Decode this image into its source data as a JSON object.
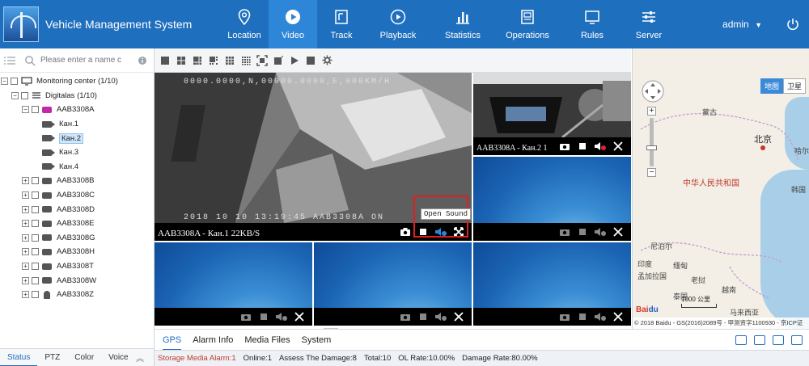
{
  "app": {
    "title": "Vehicle Management System"
  },
  "nav": [
    {
      "label": "Location",
      "icon": "location-pin-icon"
    },
    {
      "label": "Video",
      "icon": "play-circle-icon",
      "active": true
    },
    {
      "label": "Track",
      "icon": "track-icon"
    },
    {
      "label": "Playback",
      "icon": "playback-icon"
    },
    {
      "label": "Statistics",
      "icon": "bar-chart-icon"
    },
    {
      "label": "Operations",
      "icon": "operations-icon"
    },
    {
      "label": "Rules",
      "icon": "rules-icon"
    },
    {
      "label": "Server",
      "icon": "sliders-icon"
    }
  ],
  "user": {
    "name": "admin",
    "dropdown": "▼"
  },
  "search": {
    "placeholder": "Please enter a name c"
  },
  "tree": {
    "root": "Monitoring center  (1/10)",
    "group": "Digitalas  (1/10)",
    "vehicle": "AAB3308A",
    "channels": [
      "Кан.1",
      "Кан.2",
      "Кан.3",
      "Кан.4"
    ],
    "others": [
      "AAB3308B",
      "AAB3308C",
      "AAB3308D",
      "AAB3308E",
      "AAB3308G",
      "AAB3308H",
      "AAB3308T",
      "AAB3308W",
      "AAB3308Z"
    ]
  },
  "left_tabs": [
    "Status",
    "PTZ",
    "Color",
    "Voice"
  ],
  "video": {
    "main_osd_top": "0000.0000,N,00000.0000,E,000KM/H",
    "main_osd_bottom": "2018 10 10 13:19:45 AAB3308A ON",
    "main_label": "AAB3308A - Кан.1 22KB/S",
    "second_label": "AAB3308A - Кан.2 1",
    "tooltip": "Open Sound"
  },
  "bottom_tabs": [
    "GPS",
    "Alarm Info",
    "Media Files",
    "System"
  ],
  "status": {
    "alarm": "Storage Media Alarm:1",
    "online": "Online:1",
    "damage": "Assess The Damage:8",
    "total": "Total:10",
    "ol_rate": "OL Rate:10.00%",
    "damage_rate": "Damage Rate:80.00%"
  },
  "map": {
    "type_map": "地图",
    "type_sat": "卫星",
    "labels": {
      "mongolia": "蒙古",
      "beijing": "北京",
      "china": "中华人民共和国",
      "nepal": "尼泊尔",
      "mianbo": "缅甸",
      "bangladesh": "孟加拉国",
      "india": "印度",
      "thailand": "泰国",
      "laos": "老挝",
      "vietnam": "越南",
      "haerbin": "哈尔",
      "seoul": "韩国",
      "malaysia": "马来西亚"
    },
    "scale": "1000 公里",
    "footer": "© 2018 Baidu - GS(2016)2089号 - 甲测资字1100930 - 京ICP证"
  },
  "colors": {
    "brand": "#1f6fbf",
    "nav_active": "#2e86d8",
    "alarm": "#c0392b",
    "highlight": "#e02020"
  }
}
